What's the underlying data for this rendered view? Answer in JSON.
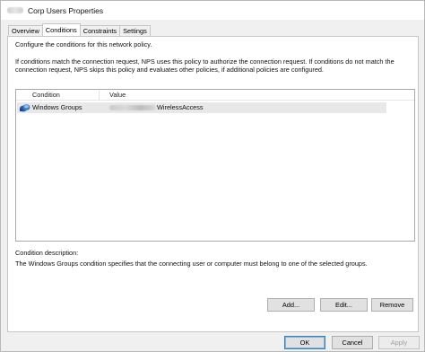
{
  "window": {
    "title": "Corp Users Properties"
  },
  "tabs": [
    {
      "label": "Overview"
    },
    {
      "label": "Conditions"
    },
    {
      "label": "Constraints"
    },
    {
      "label": "Settings"
    }
  ],
  "panel": {
    "intro": "Configure the conditions for this network policy.",
    "explanation_line1": "If conditions match the connection request, NPS uses this policy to authorize the connection request. If conditions do not match the",
    "explanation_line2": "connection request, NPS skips this policy and evaluates other policies, if additional policies are configured.",
    "list": {
      "columns": [
        "Condition",
        "Value"
      ],
      "rows": [
        {
          "condition": "Windows Groups",
          "value": "WirelessAccess",
          "icon": "windows-groups-icon"
        }
      ]
    },
    "description_label": "Condition description:",
    "description_text": "The Windows Groups condition specifies that the connecting user or computer must belong to one of the selected groups.",
    "buttons": {
      "add": "Add...",
      "edit": "Edit...",
      "remove": "Remove"
    }
  },
  "dialog_buttons": {
    "ok": "OK",
    "cancel": "Cancel",
    "apply": "Apply"
  },
  "colors": {
    "panel_bg": "#ffffff",
    "window_bg": "#f0f0f0",
    "selected_row": "#e8e8e8",
    "default_button_border": "#3c7fb1"
  }
}
